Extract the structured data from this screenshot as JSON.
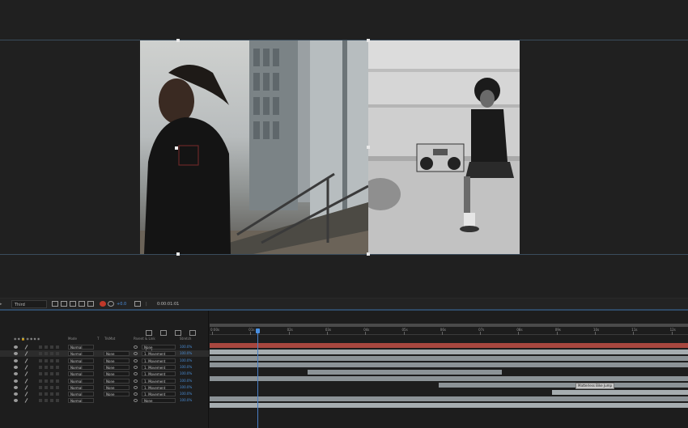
{
  "toolbar": {
    "view_select": "Third",
    "exposure_value": "+0.0",
    "timecode": "0:00:01:01",
    "icons": [
      "grid-icon",
      "mask-icon",
      "camera-icon",
      "color-wheel-icon",
      "snapshot-icon"
    ]
  },
  "timeline": {
    "columns": {
      "mode": "Mode",
      "t": "T",
      "trkmat": "TrkMat",
      "parent": "Parent & Link",
      "stretch": "Stretch"
    },
    "ruler_labels": [
      "0:00s",
      "01s",
      "02s",
      "03s",
      "04s",
      "05s",
      "06s",
      "07s",
      "08s",
      "09s",
      "10s",
      "11s",
      "12s"
    ],
    "layers": [
      {
        "mode": "Normal",
        "trkmat": "",
        "parent": "None",
        "stretch": "100.0%"
      },
      {
        "mode": "Normal",
        "trkmat": "None",
        "parent": "1. Movement",
        "stretch": "100.0%"
      },
      {
        "mode": "Normal",
        "trkmat": "None",
        "parent": "1. Movement",
        "stretch": "100.0%"
      },
      {
        "mode": "Normal",
        "trkmat": "None",
        "parent": "1. Movement",
        "stretch": "100.0%"
      },
      {
        "mode": "Normal",
        "trkmat": "None",
        "parent": "1. Movement",
        "stretch": "100.0%"
      },
      {
        "mode": "Normal",
        "trkmat": "None",
        "parent": "1. Movement",
        "stretch": "100.0%"
      },
      {
        "mode": "Normal",
        "trkmat": "None",
        "parent": "1. Movement",
        "stretch": "100.0%"
      },
      {
        "mode": "Normal",
        "trkmat": "None",
        "parent": "1. Movement",
        "stretch": "100.0%"
      },
      {
        "mode": "Normal",
        "trkmat": "",
        "parent": "None",
        "stretch": "100.0%"
      }
    ],
    "marker_label": "Matterless Bike Jump"
  },
  "colors": {
    "accent": "#4a90e2",
    "track_red": "#a8473f",
    "track_grey": "#8c9397",
    "track_light": "#a6adb0"
  }
}
